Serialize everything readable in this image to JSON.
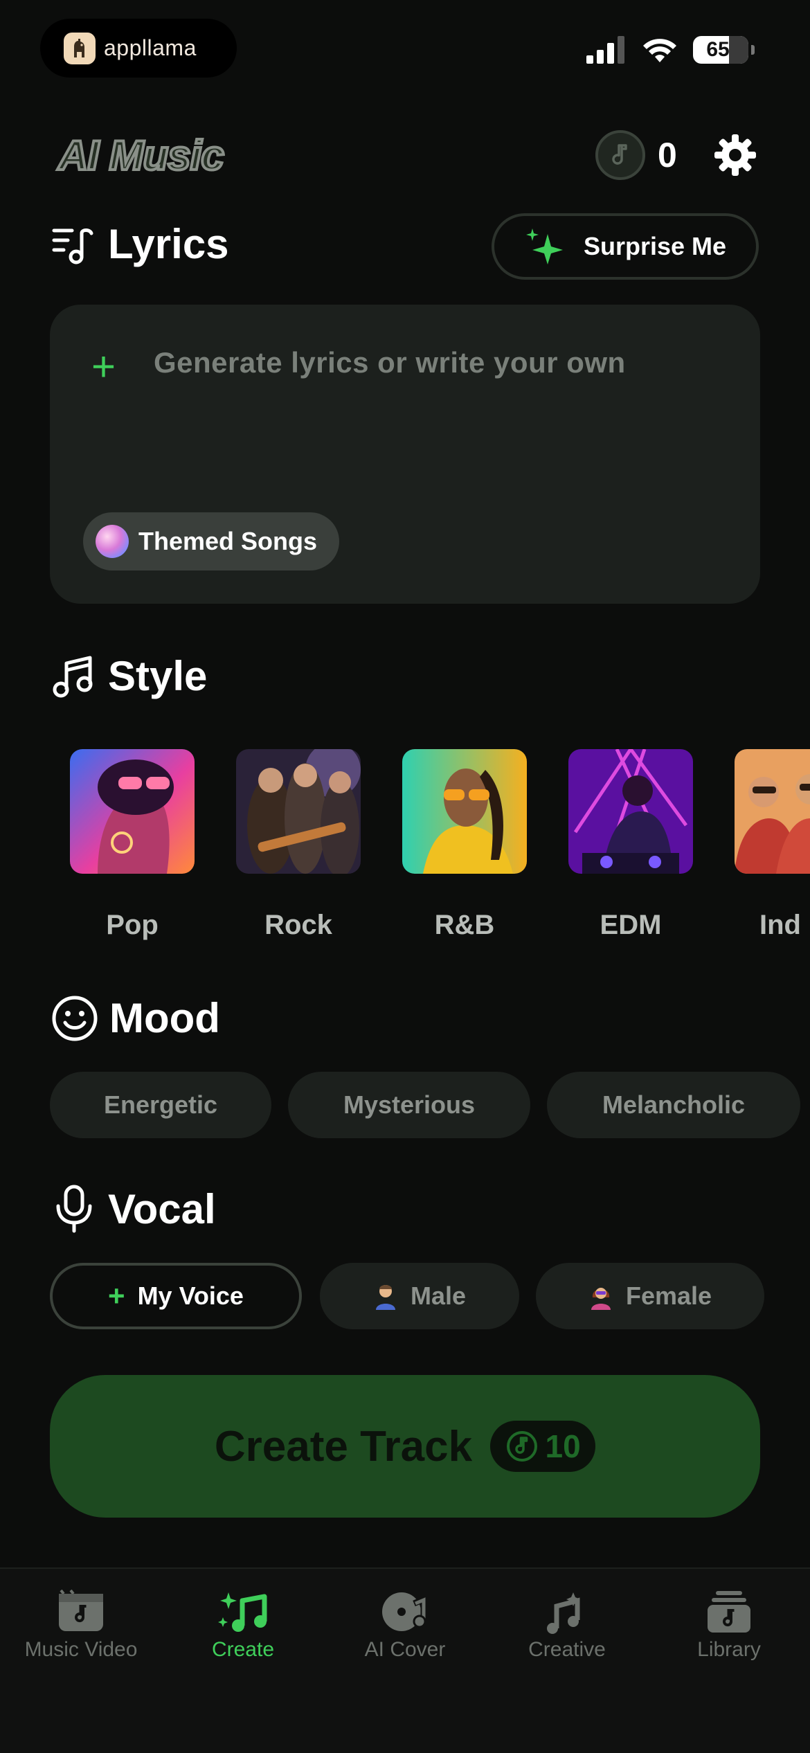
{
  "status_bar": {
    "app_name": "appllama",
    "battery": "65"
  },
  "header": {
    "brand": "AI Music",
    "credits": "0"
  },
  "lyrics": {
    "title": "Lyrics",
    "surprise_label": "Surprise Me",
    "placeholder": "Generate lyrics or write your own",
    "themed_label": "Themed Songs"
  },
  "style": {
    "title": "Style",
    "items": [
      {
        "label": "Pop"
      },
      {
        "label": "Rock"
      },
      {
        "label": "R&B"
      },
      {
        "label": "EDM"
      },
      {
        "label": "Ind"
      }
    ]
  },
  "mood": {
    "title": "Mood",
    "items": [
      {
        "label": "Energetic"
      },
      {
        "label": "Mysterious"
      },
      {
        "label": "Melancholic"
      }
    ]
  },
  "vocal": {
    "title": "Vocal",
    "my_voice": "My Voice",
    "male": "Male",
    "female": "Female"
  },
  "create": {
    "label": "Create Track",
    "cost": "10"
  },
  "nav": {
    "items": [
      {
        "label": "Music Video",
        "icon": "music-video-icon"
      },
      {
        "label": "Create",
        "icon": "create-icon",
        "active": true
      },
      {
        "label": "AI Cover",
        "icon": "ai-cover-icon"
      },
      {
        "label": "Creative",
        "icon": "creative-icon"
      },
      {
        "label": "Library",
        "icon": "library-icon"
      }
    ]
  },
  "colors": {
    "accent": "#3fcf5a",
    "background": "#0c0d0c",
    "card": "#1c201d",
    "create_button": "#1d4a20"
  }
}
